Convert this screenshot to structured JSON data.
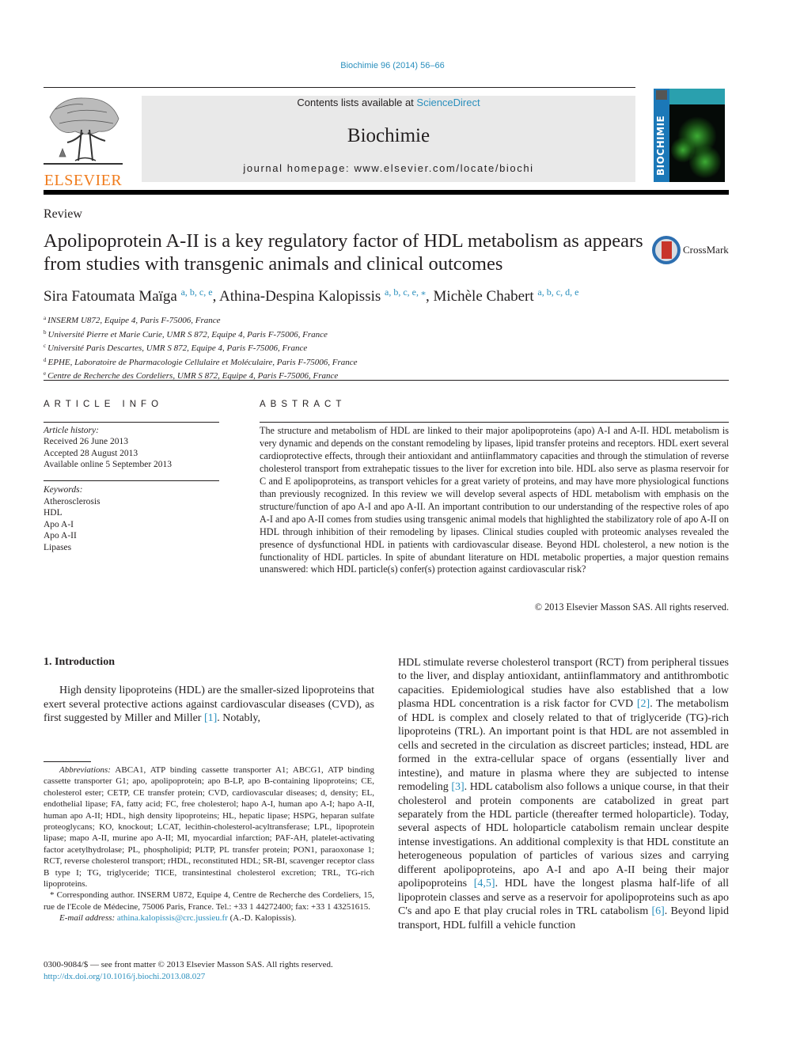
{
  "journal_ref": "Biochimie 96 (2014) 56–66",
  "masthead": {
    "contents_prefix": "Contents lists available at ",
    "contents_link": "ScienceDirect",
    "journal_title": "Biochimie",
    "homepage": "journal homepage: www.elsevier.com/locate/biochi"
  },
  "publisher_logo_text": "ELSEVIER",
  "cover": {
    "spine_text": "BIOCHIMIE"
  },
  "article_type": "Review",
  "title": "Apolipoprotein A-II is a key regulatory factor of HDL metabolism as appears from studies with transgenic animals and clinical outcomes",
  "crossmark_label": "CrossMark",
  "authors": [
    {
      "name": "Sira Fatoumata Maïga",
      "affil": "a, b, c, e",
      "sep": ", "
    },
    {
      "name": "Athina-Despina Kalopissis",
      "affil": "a, b, c, e, ⁎",
      "sep": ", "
    },
    {
      "name": "Michèle Chabert",
      "affil": "a, b, c, d, e",
      "sep": ""
    }
  ],
  "affiliations": [
    {
      "mark": "a",
      "text": "INSERM U872, Equipe 4, Paris F-75006, France"
    },
    {
      "mark": "b",
      "text": "Université Pierre et Marie Curie, UMR S 872, Equipe 4, Paris F-75006, France"
    },
    {
      "mark": "c",
      "text": "Université Paris Descartes, UMR S 872, Equipe 4, Paris F-75006, France"
    },
    {
      "mark": "d",
      "text": "EPHE, Laboratoire de Pharmacologie Cellulaire et Moléculaire, Paris F-75006, France"
    },
    {
      "mark": "e",
      "text": "Centre de Recherche des Cordeliers, UMR S 872, Equipe 4, Paris F-75006, France"
    }
  ],
  "article_info": {
    "heading": "ARTICLE INFO",
    "history_label": "Article history:",
    "history": [
      "Received 26 June 2013",
      "Accepted 28 August 2013",
      "Available online 5 September 2013"
    ],
    "keywords_label": "Keywords:",
    "keywords": [
      "Atherosclerosis",
      "HDL",
      "Apo A-I",
      "Apo A-II",
      "Lipases"
    ]
  },
  "abstract": {
    "heading": "ABSTRACT",
    "text": "The structure and metabolism of HDL are linked to their major apolipoproteins (apo) A-I and A-II. HDL metabolism is very dynamic and depends on the constant remodeling by lipases, lipid transfer proteins and receptors. HDL exert several cardioprotective effects, through their antioxidant and antiin­flammatory capacities and through the stimulation of reverse cholesterol transport from extrahepatic tissues to the liver for excretion into bile. HDL also serve as plasma reservoir for C and E apolipoproteins, as transport vehicles for a great variety of proteins, and may have more physiological functions than previously recognized. In this review we will develop several aspects of HDL metabolism with emphasis on the structure/function of apo A-I and apo A-II. An important contribution to our understanding of the respective roles of apo A-I and apo A-II comes from studies using transgenic animal models that high­lighted the stabilizatory role of apo A-II on HDL through inhibition of their remodeling by lipases. Clinical studies coupled with proteomic analyses revealed the presence of dysfunctional HDL in patients with cardiovascular disease. Beyond HDL cholesterol, a new notion is the functionality of HDL particles. In spite of abundant literature on HDL metabolic properties, a major question remains unanswered: which HDL particle(s) confer(s) protection against cardiovascular risk?",
    "copyright": "© 2013 Elsevier Masson SAS. All rights reserved."
  },
  "introduction": {
    "heading": "1.  Introduction",
    "p1_before": "High density lipoproteins (HDL) are the smaller-sized lipopro­teins that exert several protective actions against cardiovascular diseases (CVD), as first suggested by Miller and Miller ",
    "p1_ref": "[1]",
    "p1_after": ". Notably,",
    "right_segments": [
      {
        "t": "HDL stimulate reverse cholesterol transport (RCT) from peripheral tissues to the liver, and display antioxidant, antiinflammatory and antithrombotic capacities. Epidemiological studies have also established that a low plasma HDL concentration is a risk factor for CVD "
      },
      {
        "ref": "[2]"
      },
      {
        "t": ". The metabolism of HDL is complex and closely related to that of triglyceride (TG)-rich lipoproteins (TRL). An important point is that HDL are not assembled in cells and secreted in the circulation as discreet particles; instead, HDL are formed in the extra-cellular space of organs (essentially liver and intestine), and mature in plasma where they are subjected to intense remodeling "
      },
      {
        "ref": "[3]"
      },
      {
        "t": ". HDL catabolism also follows a unique course, in that their cholesterol and protein components are catabolized in great part separately from the HDL particle (thereafter termed holoparticle). Today, several aspects of HDL holoparticle catabolism remain unclear despite intense investigations. An additional complexity is that HDL constitute an heterogeneous population of particles of various sizes and carrying different apolipoproteins, apo A-I and apo A-II being their major apolipoproteins "
      },
      {
        "ref": "[4,5]"
      },
      {
        "t": ". HDL have the longest plasma half-life of all lipoprotein classes and serve as a reservoir for apo­lipoproteins such as apo C's and apo E that play crucial roles in TRL catabolism "
      },
      {
        "ref": "[6]"
      },
      {
        "t": ". Beyond lipid transport, HDL fulfill a vehicle function"
      }
    ]
  },
  "footnotes": {
    "abbr_label": "Abbreviations:",
    "abbr_text": " ABCA1, ATP binding cassette transporter A1; ABCG1, ATP binding cassette transporter G1; apo, apolipoprotein; apo B-LP, apo B-containing lipopro­teins; CE, cholesterol ester; CETP, CE transfer protein; CVD, cardiovascular diseases; d, density; EL, endothelial lipase; FA, fatty acid; FC, free cholesterol; hapo A-I, hu­man apo A-I; hapo A-II, human apo A-II; HDL, high density lipoproteins; HL, hepatic lipase; HSPG, heparan sulfate proteoglycans; KO, knockout; LCAT, lecithin-choles­terol-acyltransferase; LPL, lipoprotein lipase; mapo A-II, murine apo A-II; MI, myocardial infarction; PAF-AH, platelet-activating factor acetylhydrolase; PL, phospholipid; PLTP, PL transfer protein; PON1, paraoxonase 1; RCT, reverse cholesterol transport; rHDL, reconstituted HDL; SR-BI, scavenger receptor class B type I; TG, triglyceride; TICE, transintestinal cholesterol excretion; TRL, TG-rich lipoproteins.",
    "corresponding": "* Corresponding author. INSERM U872, Equipe 4, Centre de Recherche des Cor­deliers, 15, rue de l'Ecole de Médecine, 75006 Paris, France. Tel.: +33 1 44272400; fax: +33 1 43251615.",
    "email_label": "E-mail address:",
    "email": "athina.kalopissis@crc.jussieu.fr",
    "email_suffix": " (A.-D. Kalopissis)."
  },
  "front_matter": {
    "issn_line": "0300-9084/$ — see front matter © 2013 Elsevier Masson SAS. All rights reserved.",
    "doi": "http://dx.doi.org/10.1016/j.biochi.2013.08.027"
  },
  "colors": {
    "link": "#2a8fbd",
    "elsevier_orange": "#f07c1d",
    "masthead_bg": "#e9e9e9"
  }
}
